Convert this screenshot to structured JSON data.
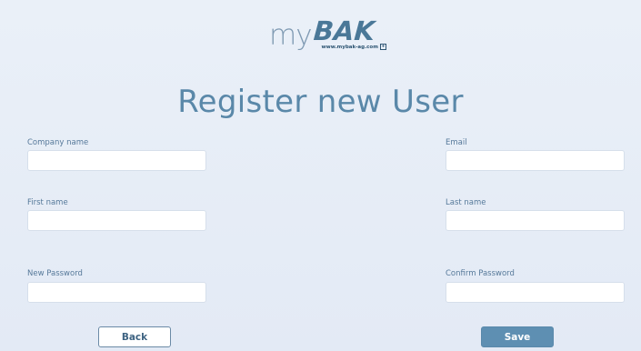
{
  "logo": {
    "my": "my",
    "bak": "BAK",
    "url": "www.mybak-ag.com"
  },
  "page": {
    "title": "Register new User"
  },
  "form": {
    "company_name": {
      "label": "Company name",
      "value": ""
    },
    "email": {
      "label": "Email",
      "value": ""
    },
    "first_name": {
      "label": "First name",
      "value": ""
    },
    "last_name": {
      "label": "Last name",
      "value": ""
    },
    "new_password": {
      "label": "New Password",
      "value": ""
    },
    "confirm_password": {
      "label": "Confirm Password",
      "value": ""
    }
  },
  "buttons": {
    "back": "Back",
    "save": "Save"
  },
  "colors": {
    "accent": "#5a88a9",
    "button_primary": "#5e8fb2",
    "background": "#e8eef7"
  }
}
